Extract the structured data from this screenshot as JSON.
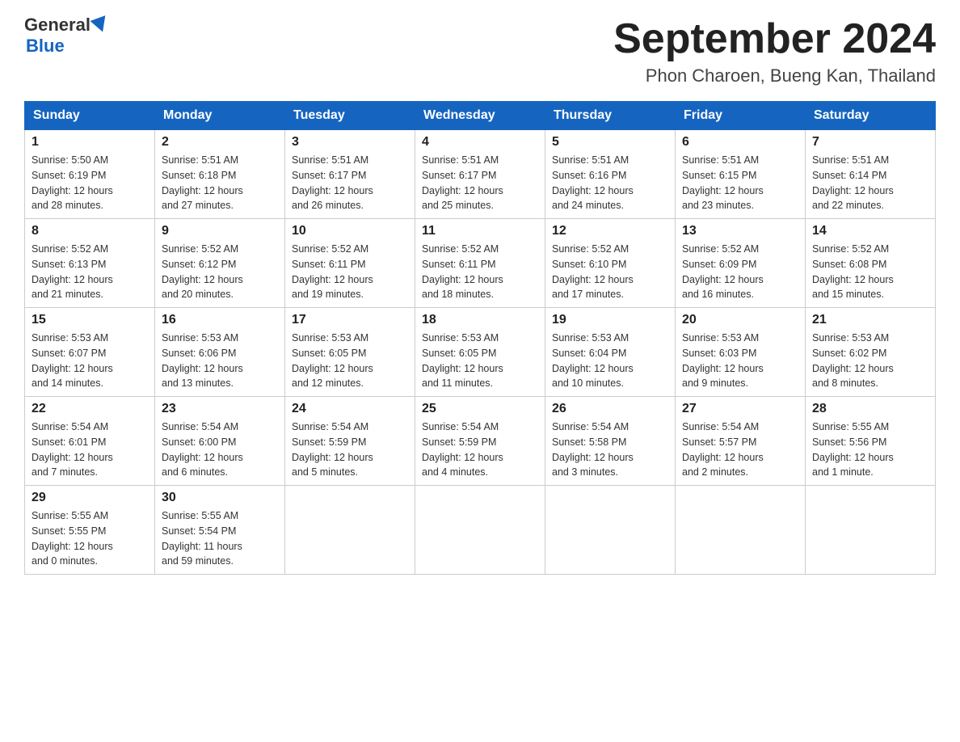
{
  "header": {
    "logo_general": "General",
    "logo_blue": "Blue",
    "month_title": "September 2024",
    "location": "Phon Charoen, Bueng Kan, Thailand"
  },
  "weekdays": [
    "Sunday",
    "Monday",
    "Tuesday",
    "Wednesday",
    "Thursday",
    "Friday",
    "Saturday"
  ],
  "weeks": [
    [
      {
        "day": "1",
        "sunrise": "5:50 AM",
        "sunset": "6:19 PM",
        "daylight": "12 hours and 28 minutes."
      },
      {
        "day": "2",
        "sunrise": "5:51 AM",
        "sunset": "6:18 PM",
        "daylight": "12 hours and 27 minutes."
      },
      {
        "day": "3",
        "sunrise": "5:51 AM",
        "sunset": "6:17 PM",
        "daylight": "12 hours and 26 minutes."
      },
      {
        "day": "4",
        "sunrise": "5:51 AM",
        "sunset": "6:17 PM",
        "daylight": "12 hours and 25 minutes."
      },
      {
        "day": "5",
        "sunrise": "5:51 AM",
        "sunset": "6:16 PM",
        "daylight": "12 hours and 24 minutes."
      },
      {
        "day": "6",
        "sunrise": "5:51 AM",
        "sunset": "6:15 PM",
        "daylight": "12 hours and 23 minutes."
      },
      {
        "day": "7",
        "sunrise": "5:51 AM",
        "sunset": "6:14 PM",
        "daylight": "12 hours and 22 minutes."
      }
    ],
    [
      {
        "day": "8",
        "sunrise": "5:52 AM",
        "sunset": "6:13 PM",
        "daylight": "12 hours and 21 minutes."
      },
      {
        "day": "9",
        "sunrise": "5:52 AM",
        "sunset": "6:12 PM",
        "daylight": "12 hours and 20 minutes."
      },
      {
        "day": "10",
        "sunrise": "5:52 AM",
        "sunset": "6:11 PM",
        "daylight": "12 hours and 19 minutes."
      },
      {
        "day": "11",
        "sunrise": "5:52 AM",
        "sunset": "6:11 PM",
        "daylight": "12 hours and 18 minutes."
      },
      {
        "day": "12",
        "sunrise": "5:52 AM",
        "sunset": "6:10 PM",
        "daylight": "12 hours and 17 minutes."
      },
      {
        "day": "13",
        "sunrise": "5:52 AM",
        "sunset": "6:09 PM",
        "daylight": "12 hours and 16 minutes."
      },
      {
        "day": "14",
        "sunrise": "5:52 AM",
        "sunset": "6:08 PM",
        "daylight": "12 hours and 15 minutes."
      }
    ],
    [
      {
        "day": "15",
        "sunrise": "5:53 AM",
        "sunset": "6:07 PM",
        "daylight": "12 hours and 14 minutes."
      },
      {
        "day": "16",
        "sunrise": "5:53 AM",
        "sunset": "6:06 PM",
        "daylight": "12 hours and 13 minutes."
      },
      {
        "day": "17",
        "sunrise": "5:53 AM",
        "sunset": "6:05 PM",
        "daylight": "12 hours and 12 minutes."
      },
      {
        "day": "18",
        "sunrise": "5:53 AM",
        "sunset": "6:05 PM",
        "daylight": "12 hours and 11 minutes."
      },
      {
        "day": "19",
        "sunrise": "5:53 AM",
        "sunset": "6:04 PM",
        "daylight": "12 hours and 10 minutes."
      },
      {
        "day": "20",
        "sunrise": "5:53 AM",
        "sunset": "6:03 PM",
        "daylight": "12 hours and 9 minutes."
      },
      {
        "day": "21",
        "sunrise": "5:53 AM",
        "sunset": "6:02 PM",
        "daylight": "12 hours and 8 minutes."
      }
    ],
    [
      {
        "day": "22",
        "sunrise": "5:54 AM",
        "sunset": "6:01 PM",
        "daylight": "12 hours and 7 minutes."
      },
      {
        "day": "23",
        "sunrise": "5:54 AM",
        "sunset": "6:00 PM",
        "daylight": "12 hours and 6 minutes."
      },
      {
        "day": "24",
        "sunrise": "5:54 AM",
        "sunset": "5:59 PM",
        "daylight": "12 hours and 5 minutes."
      },
      {
        "day": "25",
        "sunrise": "5:54 AM",
        "sunset": "5:59 PM",
        "daylight": "12 hours and 4 minutes."
      },
      {
        "day": "26",
        "sunrise": "5:54 AM",
        "sunset": "5:58 PM",
        "daylight": "12 hours and 3 minutes."
      },
      {
        "day": "27",
        "sunrise": "5:54 AM",
        "sunset": "5:57 PM",
        "daylight": "12 hours and 2 minutes."
      },
      {
        "day": "28",
        "sunrise": "5:55 AM",
        "sunset": "5:56 PM",
        "daylight": "12 hours and 1 minute."
      }
    ],
    [
      {
        "day": "29",
        "sunrise": "5:55 AM",
        "sunset": "5:55 PM",
        "daylight": "12 hours and 0 minutes."
      },
      {
        "day": "30",
        "sunrise": "5:55 AM",
        "sunset": "5:54 PM",
        "daylight": "11 hours and 59 minutes."
      },
      null,
      null,
      null,
      null,
      null
    ]
  ]
}
